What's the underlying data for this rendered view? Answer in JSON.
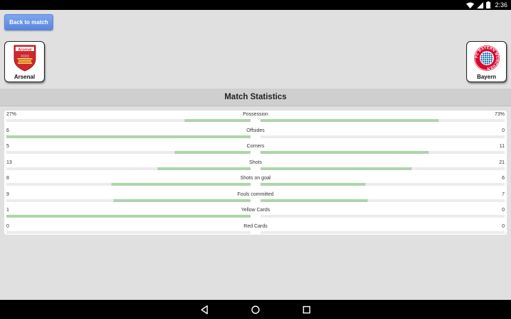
{
  "status_bar": {
    "time": "2:36"
  },
  "back_button": {
    "label": "Back to match"
  },
  "teams": {
    "home": {
      "name": "Arsenal",
      "logo_text": "Arsenal"
    },
    "away": {
      "name": "Bayern",
      "logo_text": "FC BAYERN MÜNCHEN"
    }
  },
  "stats_header": {
    "title": "Match Statistics"
  },
  "colors": {
    "bar_fill": "#aed4ab",
    "bar_track": "#ececec",
    "back_button": "#6a95e4",
    "arsenal_red": "#d0262e",
    "bayern_red": "#dc052d",
    "bayern_blue": "#0066b2"
  },
  "stats": [
    {
      "label": "Possession",
      "home": "27%",
      "away": "73%",
      "home_ratio": 0.27,
      "away_ratio": 0.73
    },
    {
      "label": "Offsides",
      "home": "6",
      "away": "0",
      "home_ratio": 1.0,
      "away_ratio": 0.0
    },
    {
      "label": "Corners",
      "home": "5",
      "away": "11",
      "home_ratio": 0.3125,
      "away_ratio": 0.6875
    },
    {
      "label": "Shots",
      "home": "13",
      "away": "21",
      "home_ratio": 0.382,
      "away_ratio": 0.618
    },
    {
      "label": "Shots on goal",
      "home": "8",
      "away": "6",
      "home_ratio": 0.571,
      "away_ratio": 0.429
    },
    {
      "label": "Fouls committed",
      "home": "9",
      "away": "7",
      "home_ratio": 0.5625,
      "away_ratio": 0.4375
    },
    {
      "label": "Yellow Cards",
      "home": "1",
      "away": "0",
      "home_ratio": 1.0,
      "away_ratio": 0.0
    },
    {
      "label": "Red Cards",
      "home": "0",
      "away": "0",
      "home_ratio": 0.0,
      "away_ratio": 0.0
    }
  ],
  "icons": {
    "status": [
      "wifi-icon",
      "signal-icon",
      "battery-icon"
    ],
    "nav": [
      "back-nav-icon",
      "home-nav-icon",
      "recents-nav-icon"
    ]
  }
}
